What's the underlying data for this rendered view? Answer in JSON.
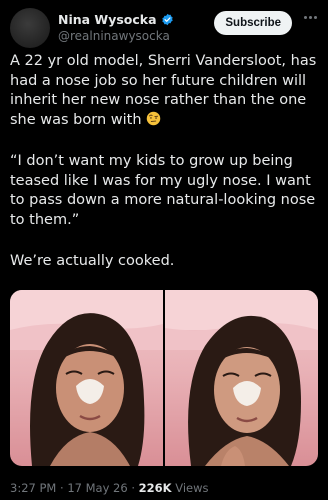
{
  "author": {
    "display_name": "Nina Wysocka",
    "handle": "@realninawysocka",
    "verified": true,
    "verified_icon": "verified-badge-icon",
    "badge_color": "#1d9bf0"
  },
  "actions": {
    "subscribe_label": "Subscribe",
    "more_icon": "more-options-icon"
  },
  "tweet": {
    "paragraph1": "A 22 yr old model, Sherri Vandersloot, has had a nose job so her future children will inherit her new nose rather than the one she was born with",
    "paragraph1_emoji": "face-with-raised-eyebrow-emoji",
    "paragraph2": "“I don’t want my kids to grow up being teased like I was for my ugly nose. I want to pass down a more natural-looking nose to them.”",
    "paragraph3": "We’re actually cooked."
  },
  "media": {
    "photos": [
      {
        "subject": "woman-with-nose-bandage-photo"
      },
      {
        "subject": "woman-with-nose-bandage-photo"
      }
    ]
  },
  "meta": {
    "time": "3:27 PM",
    "separator": " · ",
    "date": "17 May 26",
    "views_count": "226K",
    "views_label": " Views"
  },
  "colors": {
    "background": "#000000",
    "text": "#e7e9ea",
    "secondary_text": "#71767b",
    "button_bg": "#eff3f4"
  }
}
